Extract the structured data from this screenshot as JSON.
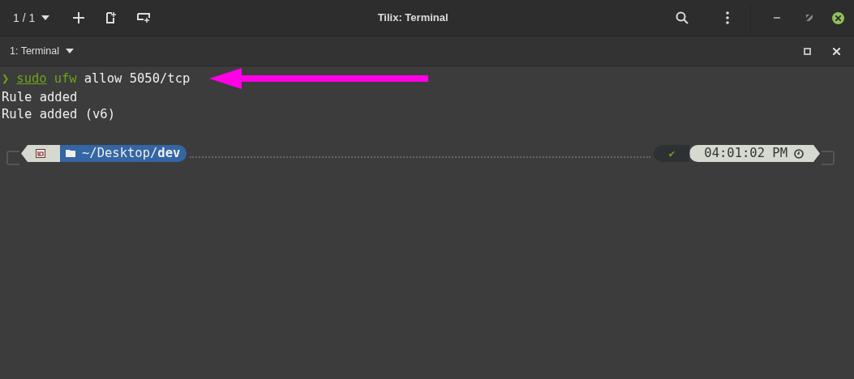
{
  "headerbar": {
    "session_switcher": "1 / 1",
    "title": "Tilix: Terminal"
  },
  "tab": {
    "label": "1: Terminal"
  },
  "terminal": {
    "command": {
      "prompt": "❯",
      "sudo": "sudo",
      "program": "ufw",
      "args": "allow 5050/tcp"
    },
    "output": [
      "Rule added",
      "Rule added (v6)"
    ],
    "status_line": {
      "path": "~/Desktop/**dev**",
      "status": "✔",
      "time": "04:01:02 PM"
    }
  }
}
